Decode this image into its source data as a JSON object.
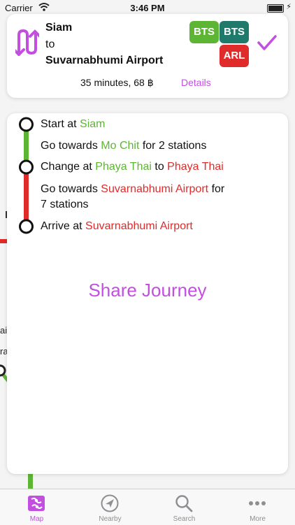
{
  "status_bar": {
    "carrier": "Carrier",
    "time": "3:46 PM"
  },
  "journey": {
    "origin": "Siam",
    "connector": "to",
    "destination": "Suvarnabhumi Airport",
    "lines": [
      {
        "label": "BTS",
        "color": "#5db534"
      },
      {
        "label": "BTS",
        "color": "#1f7a6b"
      },
      {
        "label": "ARL",
        "color": "#e02b2b"
      }
    ],
    "duration_fare": "35 minutes, 68 ฿",
    "details_label": "Details"
  },
  "steps": [
    {
      "prefix": "Start at ",
      "station": "Siam",
      "station_color": "#5db534"
    },
    {
      "prefix": "Go towards ",
      "station": "Mo Chit",
      "station_color": "#5db534",
      "suffix": " for 2 stations"
    },
    {
      "prefix": "Change at ",
      "station": "Phaya Thai",
      "station_color": "#5db534",
      "middle": " to ",
      "station2": "Phaya Thai",
      "station2_color": "#e02b2b"
    },
    {
      "prefix": "Go towards ",
      "station": "Suvarnabhumi Airport",
      "station_color": "#e02b2b",
      "suffix": " for",
      "line2": "7 stations"
    },
    {
      "prefix": "Arrive at ",
      "station": "Suvarnabhumi Airport",
      "station_color": "#e02b2b"
    }
  ],
  "share_label": "Share Journey",
  "map_fragments": [
    "ai",
    "ra"
  ],
  "tabs": [
    {
      "label": "Map",
      "icon": "map-icon",
      "active": true
    },
    {
      "label": "Nearby",
      "icon": "location-arrow-icon",
      "active": false
    },
    {
      "label": "Search",
      "icon": "magnifier-icon",
      "active": false
    },
    {
      "label": "More",
      "icon": "ellipsis-icon",
      "active": false
    }
  ],
  "colors": {
    "accent": "#c24fe0",
    "green": "#5db534",
    "red": "#e02b2b"
  }
}
